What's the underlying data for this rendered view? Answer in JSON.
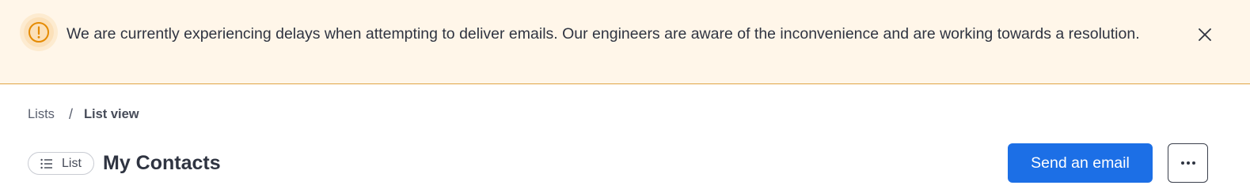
{
  "alert": {
    "icon": "warning-circle-icon",
    "message": "We are currently experiencing delays when attempting to deliver emails. Our engineers are aware of the inconvenience and are working towards a resolution.",
    "close_icon": "close-icon",
    "colors": {
      "background": "#fff6e9",
      "border": "#e0a545",
      "icon": "#e58a00"
    }
  },
  "breadcrumb": {
    "items": [
      "Lists",
      "List view"
    ],
    "separator": "/"
  },
  "header": {
    "type_chip": {
      "icon": "list-icon",
      "label": "List"
    },
    "title": "My Contacts",
    "primary_button": "Send an email",
    "more_button_icon": "more-horizontal-icon",
    "colors": {
      "primary": "#1c6fe6"
    }
  }
}
